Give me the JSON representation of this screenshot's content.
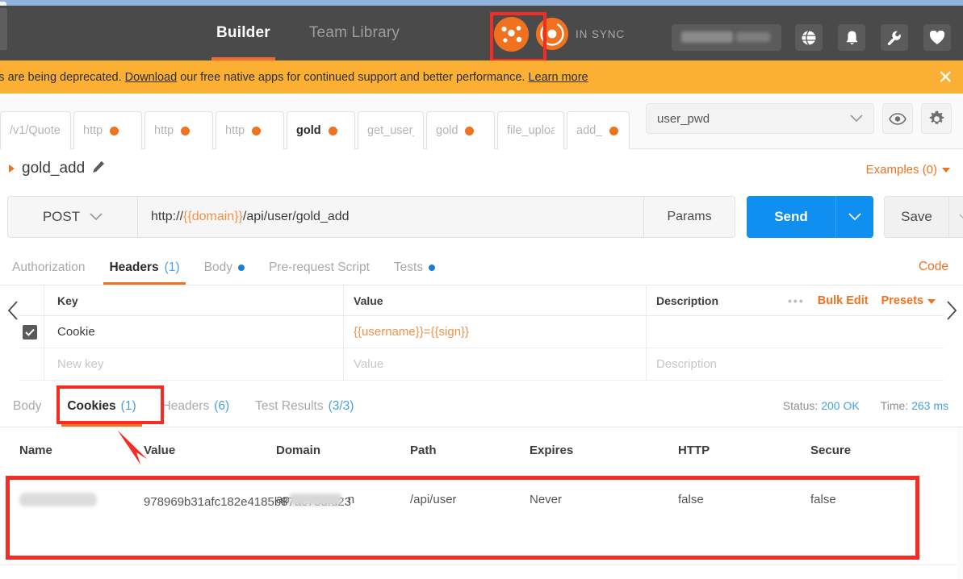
{
  "header": {
    "nav_tabs": [
      {
        "label": "Builder",
        "active": true
      },
      {
        "label": "Team Library",
        "active": false
      }
    ],
    "sync_label": "IN SYNC",
    "search_placeholder": "",
    "icons": [
      {
        "name": "globe-icon"
      },
      {
        "name": "bell-icon"
      },
      {
        "name": "wrench-icon"
      },
      {
        "name": "heart-icon"
      }
    ]
  },
  "banner": {
    "text_before_download": "e apps are being deprecated. ",
    "download_link": "Download",
    "text_middle": " our free native apps for continued support and better performance. ",
    "learn_more_link": "Learn more",
    "close_label": "✕"
  },
  "request_tabs": [
    {
      "label": "/v1/Quote",
      "dirty": false,
      "active": false
    },
    {
      "label": "http",
      "dirty": true,
      "active": false
    },
    {
      "label": "http",
      "dirty": true,
      "active": false
    },
    {
      "label": "http",
      "dirty": true,
      "active": false
    },
    {
      "label": "gold",
      "dirty": true,
      "active": true
    },
    {
      "label": "get_user_i",
      "dirty": false,
      "active": false
    },
    {
      "label": "gold",
      "dirty": true,
      "active": false
    },
    {
      "label": "file_uploa",
      "dirty": false,
      "active": false
    },
    {
      "label": "add_",
      "dirty": true,
      "active": false
    }
  ],
  "environment": {
    "selected": "user_pwd",
    "eye_icon": "eye-icon",
    "gear_icon": "gear-icon"
  },
  "request": {
    "name": "gold_add",
    "examples_label": "Examples (0)",
    "method": "POST",
    "url_prefix": "http://",
    "url_variable": "{{domain}}",
    "url_suffix": "/api/user/gold_add",
    "params_label": "Params",
    "send_label": "Send",
    "save_label": "Save"
  },
  "request_subtabs": [
    {
      "label": "Authorization",
      "count": "",
      "dot": false,
      "active": false
    },
    {
      "label": "Headers",
      "count": "(1)",
      "dot": false,
      "active": true
    },
    {
      "label": "Body",
      "count": "",
      "dot": true,
      "active": false
    },
    {
      "label": "Pre-request Script",
      "count": "",
      "dot": false,
      "active": false
    },
    {
      "label": "Tests",
      "count": "",
      "dot": true,
      "active": false
    }
  ],
  "code_link": "Code",
  "headers_table": {
    "columns": [
      "Key",
      "Value",
      "Description"
    ],
    "bulk_edit_label": "Bulk Edit",
    "presets_label": "Presets",
    "rows": [
      {
        "enabled": true,
        "key": "Cookie",
        "value": "{{username}}={{sign}}",
        "description": ""
      }
    ],
    "placeholder_row": {
      "key": "New key",
      "value": "Value",
      "description": "Description"
    }
  },
  "response": {
    "tabs": [
      {
        "label": "Body",
        "count": "",
        "active": false
      },
      {
        "label": "Cookies",
        "count": "(1)",
        "active": true
      },
      {
        "label": "Headers",
        "count": "(6)",
        "active": false
      },
      {
        "label": "Test Results",
        "count": "(3/3)",
        "active": false
      }
    ],
    "status_label": "Status:",
    "status_value": "200 OK",
    "time_label": "Time:",
    "time_value": "263 ms"
  },
  "cookies_table": {
    "columns": [
      "Name",
      "Value",
      "Domain",
      "Path",
      "Expires",
      "HTTP",
      "Secure"
    ],
    "rows": [
      {
        "name": "",
        "value": "978969b31afc182e4185b87ac73dfd23",
        "domain_prefix": "ap",
        "domain_suffix": "n",
        "path": "/api/user",
        "expires": "Never",
        "http": "false",
        "secure": "false"
      }
    ]
  },
  "annotations": {
    "highlight_color": "#f52c21",
    "boxes": [
      "logo-badge",
      "cookies-tab",
      "cookie-row"
    ],
    "arrow": "points-to-cookie-row"
  }
}
